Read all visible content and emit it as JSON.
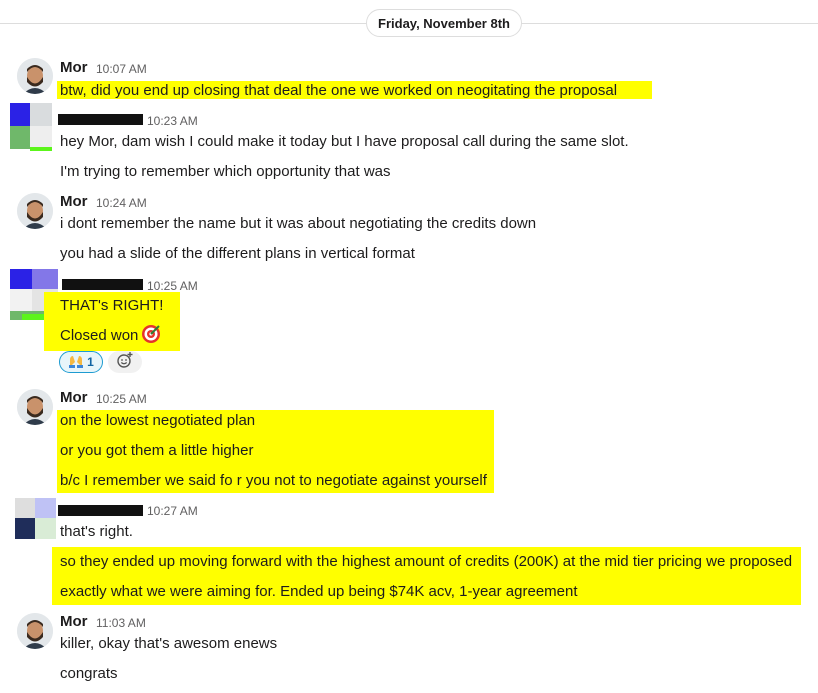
{
  "date_divider": "Friday, November 8th",
  "colors": {
    "highlight": "#ffff00",
    "reaction_border": "#1d9bd1",
    "reaction_text": "#1264a3"
  },
  "messages": [
    {
      "author": "Mor",
      "time": "10:07 AM",
      "lines": [
        "btw, did you end up closing that deal  the one we worked on neogitating the proposal"
      ]
    },
    {
      "author": "",
      "time": "10:23 AM",
      "lines": [
        "hey Mor, dam wish I could make it today but I have proposal call during the same slot.",
        "I'm trying to remember which opportunity that was"
      ]
    },
    {
      "author": "Mor",
      "time": "10:24 AM",
      "lines": [
        "i dont remember the name but it was about negotiating the credits down",
        "you had a slide of the different plans in vertical format"
      ]
    },
    {
      "author": "",
      "time": "10:25 AM",
      "lines": [
        "THAT's RIGHT!",
        "Closed won"
      ],
      "emoji": "dart-emoji",
      "reaction": {
        "icon": "raised-hands-emoji",
        "count": "1"
      }
    },
    {
      "author": "Mor",
      "time": "10:25 AM",
      "lines": [
        "on the lowest negotiated plan",
        "or you got them a little higher",
        "b/c I remember we said fo r you not to negotiate against yourself"
      ]
    },
    {
      "author": "",
      "time": "10:27 AM",
      "lines": [
        "that's right.",
        "so they ended up moving forward with the highest amount of credits (200K) at the mid tier pricing we proposed",
        "exactly what we were aiming for. Ended up being $74K acv, 1-year agreement"
      ]
    },
    {
      "author": "Mor",
      "time": "11:03 AM",
      "lines": [
        "killer, okay that's awesom enews",
        "congrats"
      ]
    }
  ]
}
